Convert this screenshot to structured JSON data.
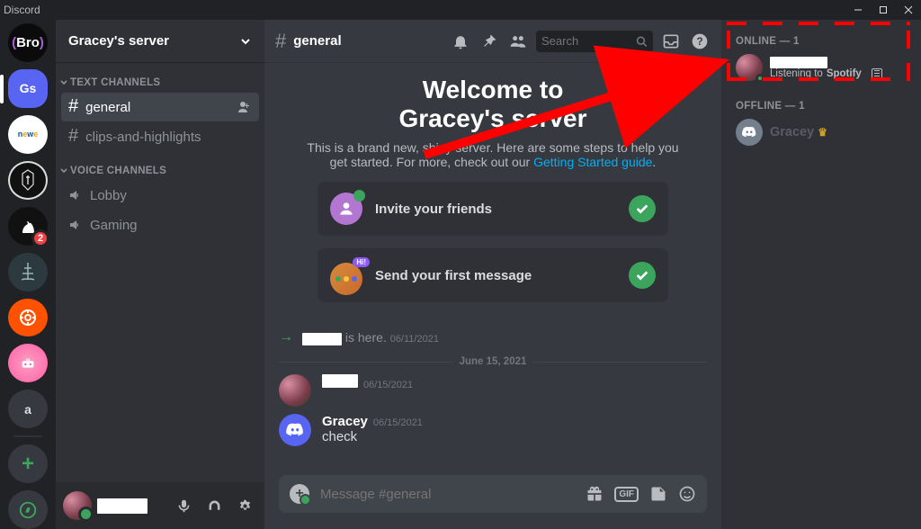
{
  "window": {
    "app_name": "Discord"
  },
  "server_rail": {
    "home_label": "Bro",
    "selected_label": "Gs",
    "letter_server": "a",
    "knight_badge": "2"
  },
  "server": {
    "name": "Gracey's server",
    "text_channels_label": "TEXT CHANNELS",
    "voice_channels_label": "VOICE CHANNELS",
    "text_channels": [
      {
        "name": "general",
        "selected": true
      },
      {
        "name": "clips-and-highlights",
        "selected": false
      }
    ],
    "voice_channels": [
      {
        "name": "Lobby"
      },
      {
        "name": "Gaming"
      }
    ]
  },
  "topbar": {
    "channel": "general",
    "search_placeholder": "Search"
  },
  "welcome": {
    "title_line1": "Welcome to",
    "title_line2": "Gracey's server",
    "subtitle_pre": "This is a brand new, shiny server. Here are some steps to help you get started. For more, check out our ",
    "subtitle_link": "Getting Started guide",
    "subtitle_post": "."
  },
  "cards": {
    "invite": "Invite your friends",
    "send": "Send your first message"
  },
  "system_message": {
    "suffix": " is here.",
    "timestamp": "06/11/2021"
  },
  "date_divider": "June 15, 2021",
  "messages": [
    {
      "name_redacted": true,
      "timestamp": "06/15/2021",
      "body": ""
    },
    {
      "name": "Gracey",
      "timestamp": "06/15/2021",
      "body": "check"
    }
  ],
  "composer": {
    "placeholder": "Message #general",
    "gif_label": "GIF"
  },
  "members": {
    "online_label": "ONLINE — 1",
    "offline_label": "OFFLINE — 1",
    "online": [
      {
        "name_redacted": true,
        "activity_pre": "Listening to ",
        "activity_bold": "Spotify"
      }
    ],
    "offline": [
      {
        "name": "Gracey",
        "owner": true
      }
    ]
  }
}
